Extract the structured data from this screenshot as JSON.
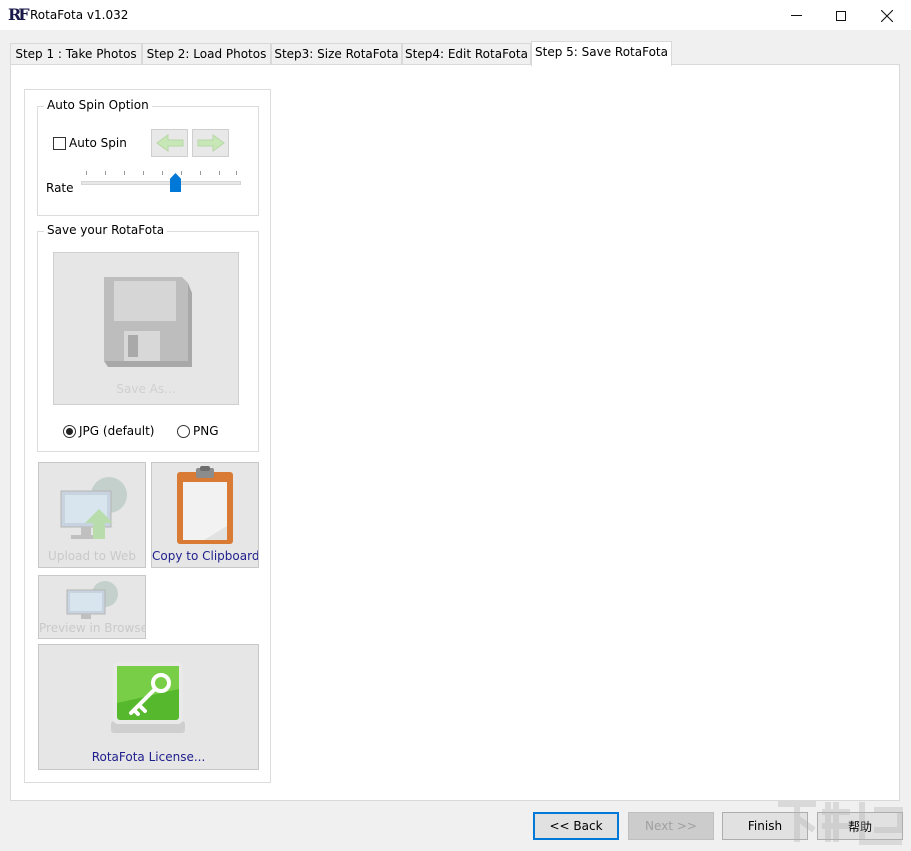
{
  "window": {
    "logo_text": "RF",
    "title": "RotaFota v1.032"
  },
  "tabs": [
    {
      "label": "Step 1 : Take Photos"
    },
    {
      "label": "Step 2: Load Photos"
    },
    {
      "label": "Step3: Size RotaFota"
    },
    {
      "label": "Step4: Edit RotaFota"
    },
    {
      "label": "Step 5: Save RotaFota",
      "active": true
    }
  ],
  "auto_spin": {
    "group_title": "Auto Spin Option",
    "checkbox_label": "Auto Spin",
    "checked": false,
    "rate_label": "Rate",
    "rate_value": 0.6
  },
  "save": {
    "group_title": "Save your RotaFota",
    "save_as_label": "Save As...",
    "formats": [
      {
        "label": "JPG (default)",
        "selected": true
      },
      {
        "label": "PNG",
        "selected": false
      }
    ]
  },
  "actions": {
    "upload_label": "Upload to Web",
    "clipboard_label": "Copy to Clipboard",
    "preview_label": "Preview in Browser",
    "license_label": "RotaFota License..."
  },
  "footer": {
    "back_label": "<< Back",
    "next_label": "Next >>",
    "finish_label": "Finish",
    "help_label": "帮助"
  },
  "colors": {
    "accent": "#0078d7",
    "link_text": "#1e1e8c"
  }
}
